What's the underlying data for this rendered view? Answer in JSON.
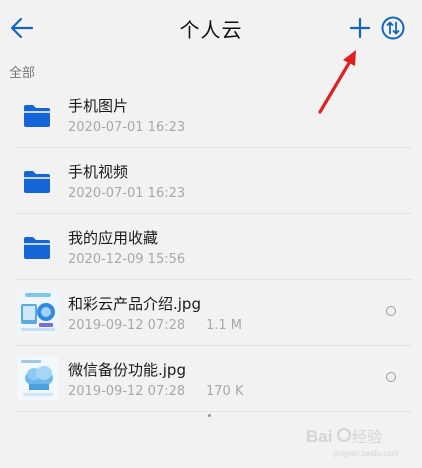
{
  "header": {
    "title": "个人云",
    "back_icon": "arrow-left-icon",
    "add_icon": "plus-icon",
    "sort_icon": "sort-circle-icon",
    "accent_color": "#1565c0"
  },
  "section": {
    "label": "全部"
  },
  "files": [
    {
      "type": "folder",
      "name": "手机图片",
      "date": "2020-07-01 16:23",
      "size": ""
    },
    {
      "type": "folder",
      "name": "手机视频",
      "date": "2020-07-01 16:23",
      "size": ""
    },
    {
      "type": "folder",
      "name": "我的应用收藏",
      "date": "2020-12-09 15:56",
      "size": ""
    },
    {
      "type": "image",
      "name": "和彩云产品介绍.jpg",
      "date": "2019-09-12 07:28",
      "size": "1.1 M"
    },
    {
      "type": "image",
      "name": "微信备份功能.jpg",
      "date": "2019-09-12 07:28",
      "size": "170 K"
    }
  ],
  "colors": {
    "folder": "#1565d8",
    "annotation_arrow": "#e02020"
  },
  "watermark": {
    "text": "Baidu经验",
    "sub": "jingyan.baidu.com"
  }
}
